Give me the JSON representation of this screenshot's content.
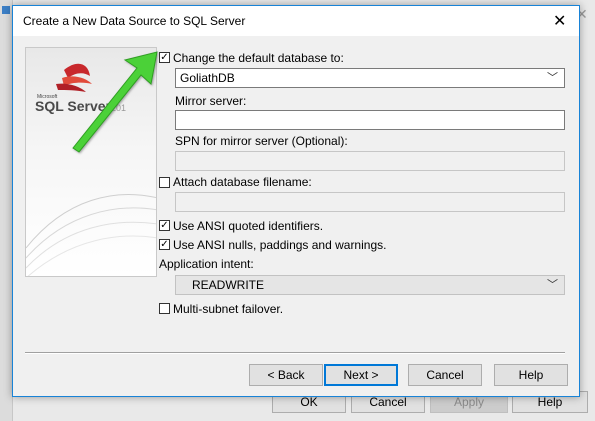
{
  "background_dialog": {
    "buttons": {
      "ok": "OK",
      "cancel": "Cancel",
      "apply": "Apply",
      "help": "Help"
    }
  },
  "dialog": {
    "title": "Create a New Data Source to SQL Server",
    "close_glyph": "✕",
    "logo": {
      "brand_small": "Microsoft",
      "brand": "SQL Server",
      "year_fragment": "201"
    },
    "change_default_db": {
      "label": "Change the default database to:",
      "checked": true,
      "value": "GoliathDB"
    },
    "mirror_server": {
      "label": "Mirror server:",
      "value": ""
    },
    "spn_mirror": {
      "label": "SPN for mirror server (Optional):",
      "value": ""
    },
    "attach_db": {
      "label": "Attach database filename:",
      "checked": false,
      "value": ""
    },
    "ansi_quoted": {
      "label": "Use ANSI quoted identifiers.",
      "checked": true
    },
    "ansi_nulls": {
      "label": "Use ANSI nulls, paddings and warnings.",
      "checked": true
    },
    "application_intent": {
      "label": "Application intent:",
      "value": "READWRITE"
    },
    "multisubnet": {
      "label": "Multi-subnet failover.",
      "checked": false
    },
    "buttons": {
      "back": "< Back",
      "next": "Next >",
      "cancel": "Cancel",
      "help": "Help"
    }
  },
  "icons": {
    "checkmark": "✓",
    "chevron_down": "﹀",
    "arrow_color": "#4cd137"
  }
}
